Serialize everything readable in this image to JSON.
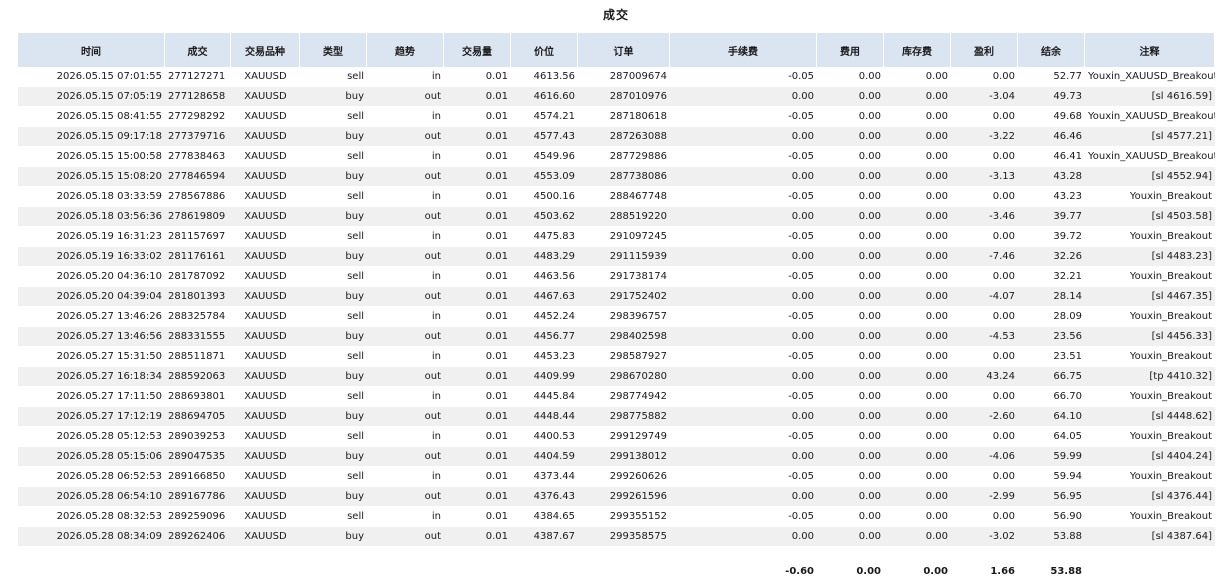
{
  "title": "成交",
  "columns": [
    "时间",
    "成交",
    "交易品种",
    "类型",
    "趋势",
    "交易量",
    "价位",
    "订单",
    "手续费",
    "费用",
    "库存费",
    "盈利",
    "结余",
    "注释"
  ],
  "rows": [
    [
      "2026.05.15 07:01:55",
      "277127271",
      "XAUUSD",
      "sell",
      "in",
      "0.01",
      "4613.56",
      "287009674",
      "-0.05",
      "0.00",
      "0.00",
      "0.00",
      "52.77",
      "Youxin_XAUUSD_Breakout"
    ],
    [
      "2026.05.15 07:05:19",
      "277128658",
      "XAUUSD",
      "buy",
      "out",
      "0.01",
      "4616.60",
      "287010976",
      "0.00",
      "0.00",
      "0.00",
      "-3.04",
      "49.73",
      "[sl 4616.59]"
    ],
    [
      "2026.05.15 08:41:55",
      "277298292",
      "XAUUSD",
      "sell",
      "in",
      "0.01",
      "4574.21",
      "287180618",
      "-0.05",
      "0.00",
      "0.00",
      "0.00",
      "49.68",
      "Youxin_XAUUSD_Breakout"
    ],
    [
      "2026.05.15 09:17:18",
      "277379716",
      "XAUUSD",
      "buy",
      "out",
      "0.01",
      "4577.43",
      "287263088",
      "0.00",
      "0.00",
      "0.00",
      "-3.22",
      "46.46",
      "[sl 4577.21]"
    ],
    [
      "2026.05.15 15:00:58",
      "277838463",
      "XAUUSD",
      "sell",
      "in",
      "0.01",
      "4549.96",
      "287729886",
      "-0.05",
      "0.00",
      "0.00",
      "0.00",
      "46.41",
      "Youxin_XAUUSD_Breakout"
    ],
    [
      "2026.05.15 15:08:20",
      "277846594",
      "XAUUSD",
      "buy",
      "out",
      "0.01",
      "4553.09",
      "287738086",
      "0.00",
      "0.00",
      "0.00",
      "-3.13",
      "43.28",
      "[sl 4552.94]"
    ],
    [
      "2026.05.18 03:33:59",
      "278567886",
      "XAUUSD",
      "sell",
      "in",
      "0.01",
      "4500.16",
      "288467748",
      "-0.05",
      "0.00",
      "0.00",
      "0.00",
      "43.23",
      "Youxin_Breakout"
    ],
    [
      "2026.05.18 03:56:36",
      "278619809",
      "XAUUSD",
      "buy",
      "out",
      "0.01",
      "4503.62",
      "288519220",
      "0.00",
      "0.00",
      "0.00",
      "-3.46",
      "39.77",
      "[sl 4503.58]"
    ],
    [
      "2026.05.19 16:31:23",
      "281157697",
      "XAUUSD",
      "sell",
      "in",
      "0.01",
      "4475.83",
      "291097245",
      "-0.05",
      "0.00",
      "0.00",
      "0.00",
      "39.72",
      "Youxin_Breakout"
    ],
    [
      "2026.05.19 16:33:02",
      "281176161",
      "XAUUSD",
      "buy",
      "out",
      "0.01",
      "4483.29",
      "291115939",
      "0.00",
      "0.00",
      "0.00",
      "-7.46",
      "32.26",
      "[sl 4483.23]"
    ],
    [
      "2026.05.20 04:36:10",
      "281787092",
      "XAUUSD",
      "sell",
      "in",
      "0.01",
      "4463.56",
      "291738174",
      "-0.05",
      "0.00",
      "0.00",
      "0.00",
      "32.21",
      "Youxin_Breakout"
    ],
    [
      "2026.05.20 04:39:04",
      "281801393",
      "XAUUSD",
      "buy",
      "out",
      "0.01",
      "4467.63",
      "291752402",
      "0.00",
      "0.00",
      "0.00",
      "-4.07",
      "28.14",
      "[sl 4467.35]"
    ],
    [
      "2026.05.27 13:46:26",
      "288325784",
      "XAUUSD",
      "sell",
      "in",
      "0.01",
      "4452.24",
      "298396757",
      "-0.05",
      "0.00",
      "0.00",
      "0.00",
      "28.09",
      "Youxin_Breakout"
    ],
    [
      "2026.05.27 13:46:56",
      "288331555",
      "XAUUSD",
      "buy",
      "out",
      "0.01",
      "4456.77",
      "298402598",
      "0.00",
      "0.00",
      "0.00",
      "-4.53",
      "23.56",
      "[sl 4456.33]"
    ],
    [
      "2026.05.27 15:31:50",
      "288511871",
      "XAUUSD",
      "sell",
      "in",
      "0.01",
      "4453.23",
      "298587927",
      "-0.05",
      "0.00",
      "0.00",
      "0.00",
      "23.51",
      "Youxin_Breakout"
    ],
    [
      "2026.05.27 16:18:34",
      "288592063",
      "XAUUSD",
      "buy",
      "out",
      "0.01",
      "4409.99",
      "298670280",
      "0.00",
      "0.00",
      "0.00",
      "43.24",
      "66.75",
      "[tp 4410.32]"
    ],
    [
      "2026.05.27 17:11:50",
      "288693801",
      "XAUUSD",
      "sell",
      "in",
      "0.01",
      "4445.84",
      "298774942",
      "-0.05",
      "0.00",
      "0.00",
      "0.00",
      "66.70",
      "Youxin_Breakout"
    ],
    [
      "2026.05.27 17:12:19",
      "288694705",
      "XAUUSD",
      "buy",
      "out",
      "0.01",
      "4448.44",
      "298775882",
      "0.00",
      "0.00",
      "0.00",
      "-2.60",
      "64.10",
      "[sl 4448.62]"
    ],
    [
      "2026.05.28 05:12:53",
      "289039253",
      "XAUUSD",
      "sell",
      "in",
      "0.01",
      "4400.53",
      "299129749",
      "-0.05",
      "0.00",
      "0.00",
      "0.00",
      "64.05",
      "Youxin_Breakout"
    ],
    [
      "2026.05.28 05:15:06",
      "289047535",
      "XAUUSD",
      "buy",
      "out",
      "0.01",
      "4404.59",
      "299138012",
      "0.00",
      "0.00",
      "0.00",
      "-4.06",
      "59.99",
      "[sl 4404.24]"
    ],
    [
      "2026.05.28 06:52:53",
      "289166850",
      "XAUUSD",
      "sell",
      "in",
      "0.01",
      "4373.44",
      "299260626",
      "-0.05",
      "0.00",
      "0.00",
      "0.00",
      "59.94",
      "Youxin_Breakout"
    ],
    [
      "2026.05.28 06:54:10",
      "289167786",
      "XAUUSD",
      "buy",
      "out",
      "0.01",
      "4376.43",
      "299261596",
      "0.00",
      "0.00",
      "0.00",
      "-2.99",
      "56.95",
      "[sl 4376.44]"
    ],
    [
      "2026.05.28 08:32:53",
      "289259096",
      "XAUUSD",
      "sell",
      "in",
      "0.01",
      "4384.65",
      "299355152",
      "-0.05",
      "0.00",
      "0.00",
      "0.00",
      "56.90",
      "Youxin_Breakout"
    ],
    [
      "2026.05.28 08:34:09",
      "289262406",
      "XAUUSD",
      "buy",
      "out",
      "0.01",
      "4387.67",
      "299358575",
      "0.00",
      "0.00",
      "0.00",
      "-3.02",
      "53.88",
      "[sl 4387.64]"
    ]
  ],
  "totals": {
    "commission": "-0.60",
    "fee": "0.00",
    "swap": "0.00",
    "profit": "1.66",
    "balance": "53.88"
  }
}
